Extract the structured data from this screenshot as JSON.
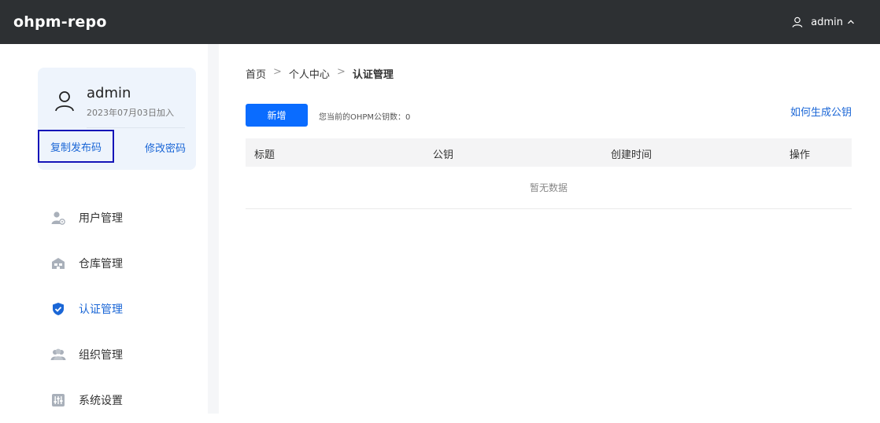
{
  "header": {
    "brand": "ohpm-repo",
    "user_name": "admin",
    "icons": {
      "user": "user-icon",
      "chevron": "chevron-up-icon"
    }
  },
  "profile": {
    "name": "admin",
    "joined": "2023年07月03日加入",
    "copy_button": "复制发布码",
    "change_password": "修改密码"
  },
  "sidebar": {
    "items": [
      {
        "label": "用户管理",
        "icon": "user-gear-icon",
        "active": false
      },
      {
        "label": "仓库管理",
        "icon": "warehouse-icon",
        "active": false
      },
      {
        "label": "认证管理",
        "icon": "shield-check-icon",
        "active": true
      },
      {
        "label": "组织管理",
        "icon": "group-icon",
        "active": false
      },
      {
        "label": "系统设置",
        "icon": "sliders-icon",
        "active": false
      }
    ]
  },
  "breadcrumb": {
    "items": [
      "首页",
      "个人中心",
      "认证管理"
    ],
    "separator": ">"
  },
  "toolbar": {
    "add_button": "新增",
    "key_count_text": "您当前的OHPM公钥数：0",
    "how_link": "如何生成公钥"
  },
  "table": {
    "columns": [
      "标题",
      "公钥",
      "创建时间",
      "操作"
    ],
    "empty_text": "暂无数据"
  },
  "colors": {
    "topbar": "#2d3033",
    "accent": "#0a6cff",
    "link": "#1a66d6",
    "card_bg": "#eef4fc"
  }
}
